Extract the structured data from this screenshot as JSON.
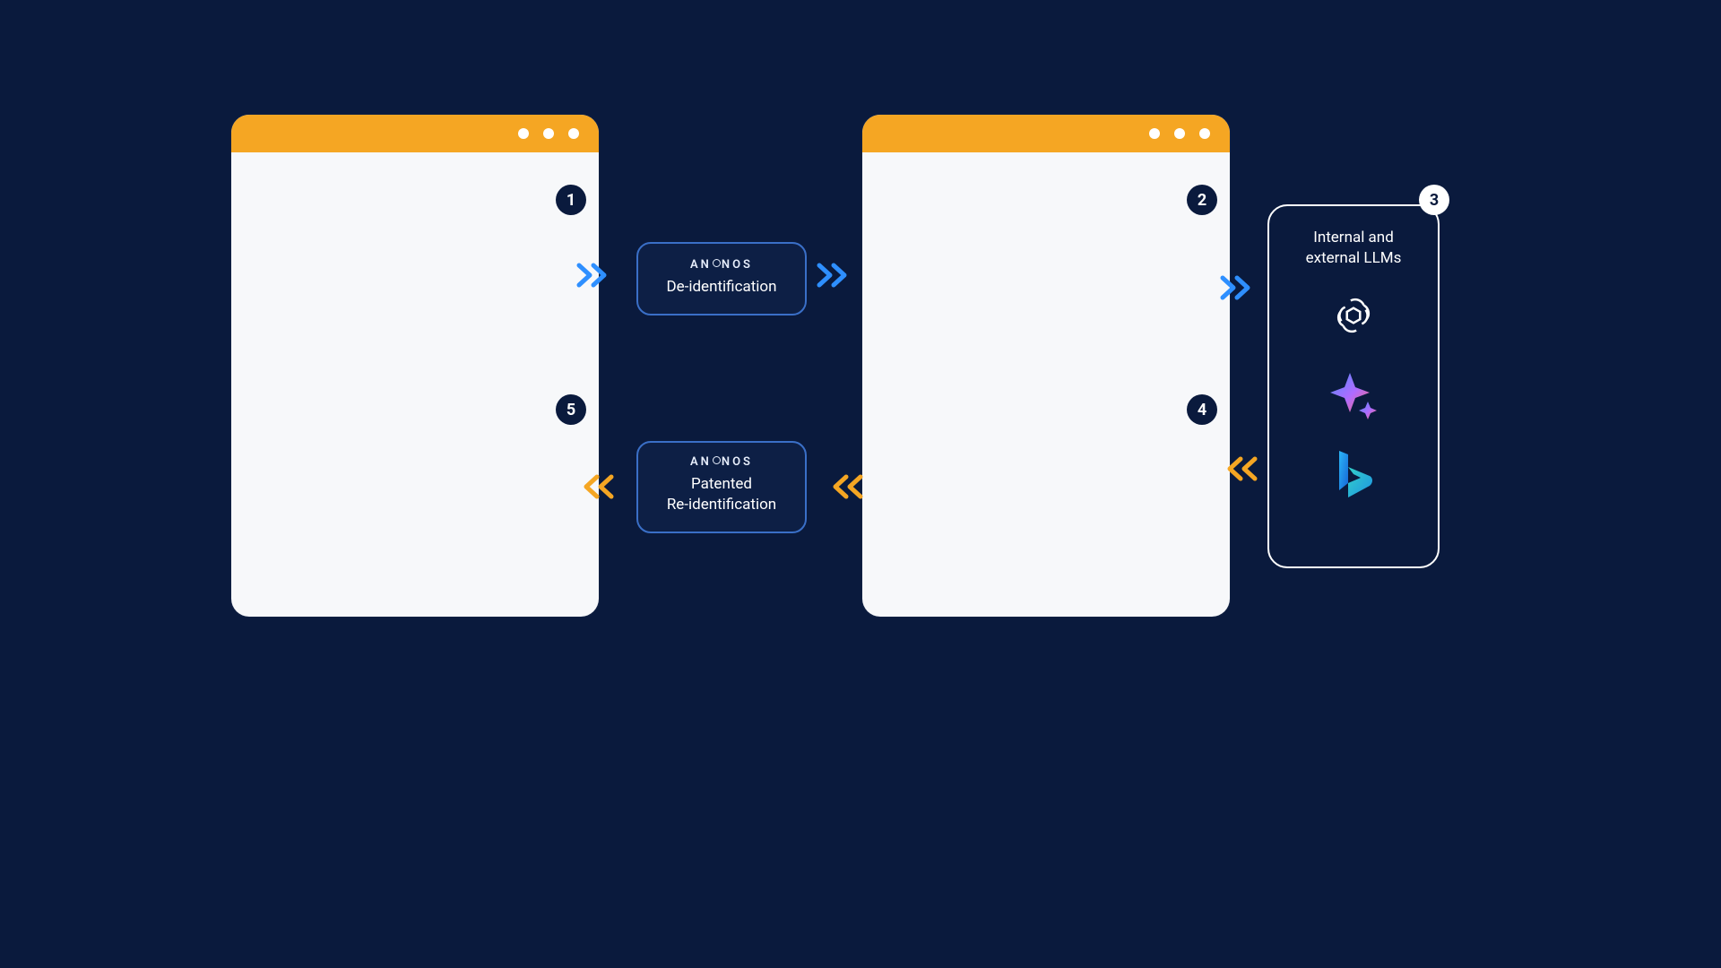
{
  "badges": {
    "b1": "1",
    "b2": "2",
    "b3": "3",
    "b4": "4",
    "b5": "5"
  },
  "brand": {
    "prefix": "AN",
    "suffix": "NOS"
  },
  "proc": {
    "top_label": "De-identification",
    "bot_line1": "Patented",
    "bot_line2": "Re-identification"
  },
  "llm": {
    "title_line1": "Internal and",
    "title_line2": "external LLMs",
    "icons": [
      "openai-icon",
      "bard-sparkle-icon",
      "bing-icon"
    ]
  },
  "colors": {
    "bg": "#0a1a3d",
    "accent_orange": "#f5a623",
    "accent_blue": "#2e8fff"
  }
}
